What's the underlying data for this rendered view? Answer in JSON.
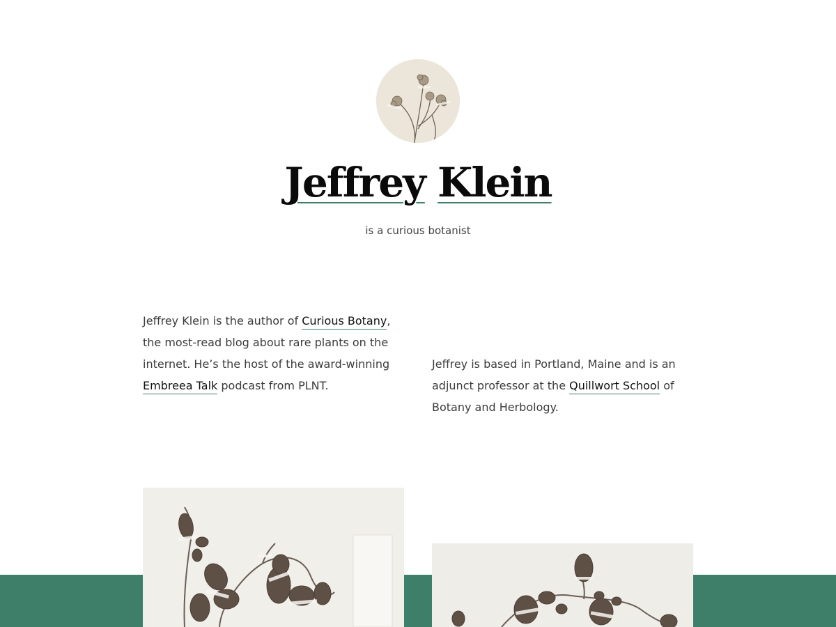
{
  "profile": {
    "name_first": "Jeffrey",
    "name_last": "Klein",
    "tagline": "is a curious botanist",
    "avatar_icon": "pressed-flower-avatar"
  },
  "bio": {
    "left": {
      "text_1": "Jeffrey Klein is the author of ",
      "link_1": "Curious Botany",
      "text_2": ", the most-read blog about rare plants on the internet. He’s the host of the award-winning ",
      "link_2": "Embreea Talk",
      "text_3": " podcast from PLNT."
    },
    "right": {
      "text_1": "Jeffrey is based in Portland, Maine and is an adjunct professor at the ",
      "link_1": "Quillwort School",
      "text_2": " of Botany and Herbology."
    }
  },
  "colors": {
    "accent": "#3d7f68",
    "title": "#0a0a0a",
    "body_text": "#3b3b3b",
    "background": "#ffffff"
  },
  "gallery": {
    "images": [
      {
        "icon": "herbarium-specimen-vine"
      },
      {
        "icon": "herbarium-specimen-leaves"
      }
    ]
  }
}
